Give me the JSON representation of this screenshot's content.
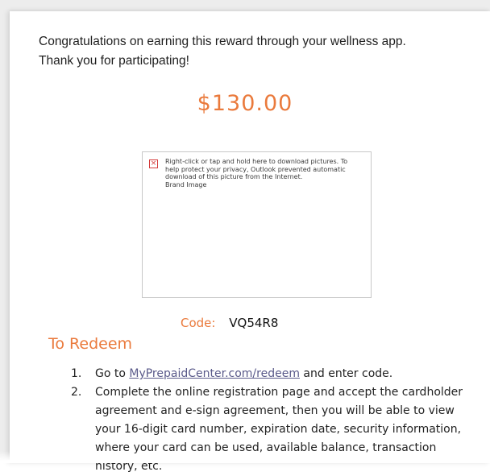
{
  "message": {
    "intro_line1": "Congratulations on earning this reward through your wellness app.",
    "intro_line2": "Thank you for participating!",
    "amount": "$130.00"
  },
  "image_placeholder": {
    "icon": "broken-image-icon",
    "text": "Right-click or tap and hold here to download pictures. To help protect your privacy, Outlook prevented automatic download of this picture from the Internet.",
    "alt": "Brand Image"
  },
  "code": {
    "label": "Code:",
    "value": "VQ54R8"
  },
  "redeem": {
    "heading": "To Redeem",
    "steps": [
      {
        "num": "1.",
        "pre": "Go to ",
        "link": "MyPrepaidCenter.com/redeem",
        "post": " and enter code."
      },
      {
        "num": "2.",
        "text": "Complete the online registration page and accept the cardholder agreement and e-sign agreement, then you will be able to view your 16-digit card number, expiration date, security information, where your card can be used, available balance, transaction history, etc."
      }
    ]
  },
  "colors": {
    "accent_orange": "#ea7a3c",
    "text": "#1f1f1f",
    "link": "#5a5a8a"
  }
}
